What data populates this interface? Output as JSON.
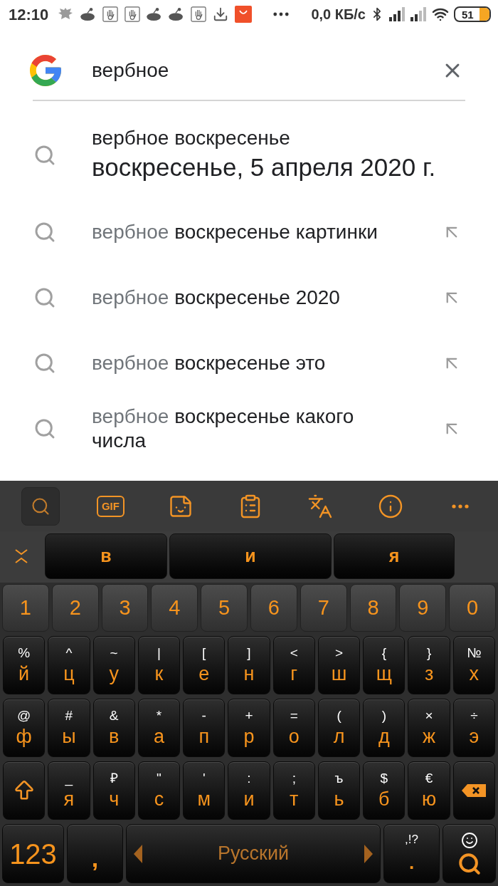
{
  "status_bar": {
    "time": "12:10",
    "network_speed": "0,0 КБ/с",
    "battery": "51"
  },
  "search": {
    "query": "вербное"
  },
  "suggestions": [
    {
      "kind": "answer",
      "query": "вербное воскресенье",
      "answer": "воскресенье, 5 апреля 2020 г."
    },
    {
      "kind": "completion",
      "typed": "вербное",
      "completion": "воскресенье картинки"
    },
    {
      "kind": "completion",
      "typed": "вербное",
      "completion": "воскресенье 2020"
    },
    {
      "kind": "completion",
      "typed": "вербное",
      "completion": "воскресенье это"
    },
    {
      "kind": "completion",
      "typed": "вербное",
      "completion": "воскресенье какого числа"
    }
  ],
  "keyboard": {
    "toolbar": [
      {
        "kind": "search",
        "selected": true
      },
      {
        "kind": "gif",
        "label": "GIF",
        "selected": false
      },
      {
        "kind": "sticker",
        "selected": false
      },
      {
        "kind": "clipboard",
        "selected": false
      },
      {
        "kind": "translate",
        "selected": false
      },
      {
        "kind": "info",
        "selected": false
      },
      {
        "kind": "more",
        "selected": false
      }
    ],
    "predictions": [
      "в",
      "и",
      "я"
    ],
    "number_row": [
      "1",
      "2",
      "3",
      "4",
      "5",
      "6",
      "7",
      "8",
      "9",
      "0"
    ],
    "letter_rows": [
      [
        {
          "hint": "%",
          "letter": "й"
        },
        {
          "hint": "^",
          "letter": "ц"
        },
        {
          "hint": "~",
          "letter": "у"
        },
        {
          "hint": "|",
          "letter": "к"
        },
        {
          "hint": "[",
          "letter": "е"
        },
        {
          "hint": "]",
          "letter": "н"
        },
        {
          "hint": "<",
          "letter": "г"
        },
        {
          "hint": ">",
          "letter": "ш"
        },
        {
          "hint": "{",
          "letter": "щ"
        },
        {
          "hint": "}",
          "letter": "з"
        },
        {
          "hint": "№",
          "letter": "х"
        }
      ],
      [
        {
          "hint": "@",
          "letter": "ф"
        },
        {
          "hint": "#",
          "letter": "ы"
        },
        {
          "hint": "&",
          "letter": "в"
        },
        {
          "hint": "*",
          "letter": "а"
        },
        {
          "hint": "-",
          "letter": "п"
        },
        {
          "hint": "+",
          "letter": "р"
        },
        {
          "hint": "=",
          "letter": "о"
        },
        {
          "hint": "(",
          "letter": "л"
        },
        {
          "hint": ")",
          "letter": "д"
        },
        {
          "hint": "×",
          "letter": "ж"
        },
        {
          "hint": "÷",
          "letter": "э"
        }
      ],
      [
        {
          "hint": "_",
          "letter": "я"
        },
        {
          "hint": "₽",
          "letter": "ч"
        },
        {
          "hint": "\"",
          "letter": "с"
        },
        {
          "hint": "'",
          "letter": "м"
        },
        {
          "hint": ":",
          "letter": "и"
        },
        {
          "hint": ";",
          "letter": "т"
        },
        {
          "hint": "ъ",
          "letter": "ь"
        },
        {
          "hint": "$",
          "letter": "б"
        },
        {
          "hint": "€",
          "letter": "ю"
        }
      ]
    ],
    "bottom_row": {
      "numbers_key": "123",
      "comma_key": ",",
      "space_label": "Русский",
      "period_hint": ",!?",
      "period_key": "."
    }
  }
}
